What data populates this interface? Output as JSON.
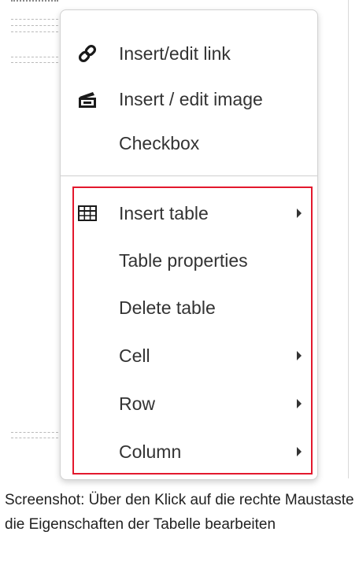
{
  "context_menu": {
    "items": [
      {
        "label": "Insert/edit link",
        "icon": "link-icon",
        "submenu": false
      },
      {
        "label": "Insert / edit image",
        "icon": "image-icon",
        "submenu": false
      },
      {
        "label": "Checkbox",
        "icon": "",
        "submenu": false
      },
      {
        "label": "Insert table",
        "icon": "table-icon",
        "submenu": true
      },
      {
        "label": "Table properties",
        "icon": "",
        "submenu": false
      },
      {
        "label": "Delete table",
        "icon": "",
        "submenu": false
      },
      {
        "label": "Cell",
        "icon": "",
        "submenu": true
      },
      {
        "label": "Row",
        "icon": "",
        "submenu": true
      },
      {
        "label": "Column",
        "icon": "",
        "submenu": true
      }
    ]
  },
  "highlight_color": "#e3182d",
  "caption": {
    "text": "Screenshot: Über den Klick auf die rechte Maustaste die Eigenschaften der Tabelle bearbeiten"
  }
}
